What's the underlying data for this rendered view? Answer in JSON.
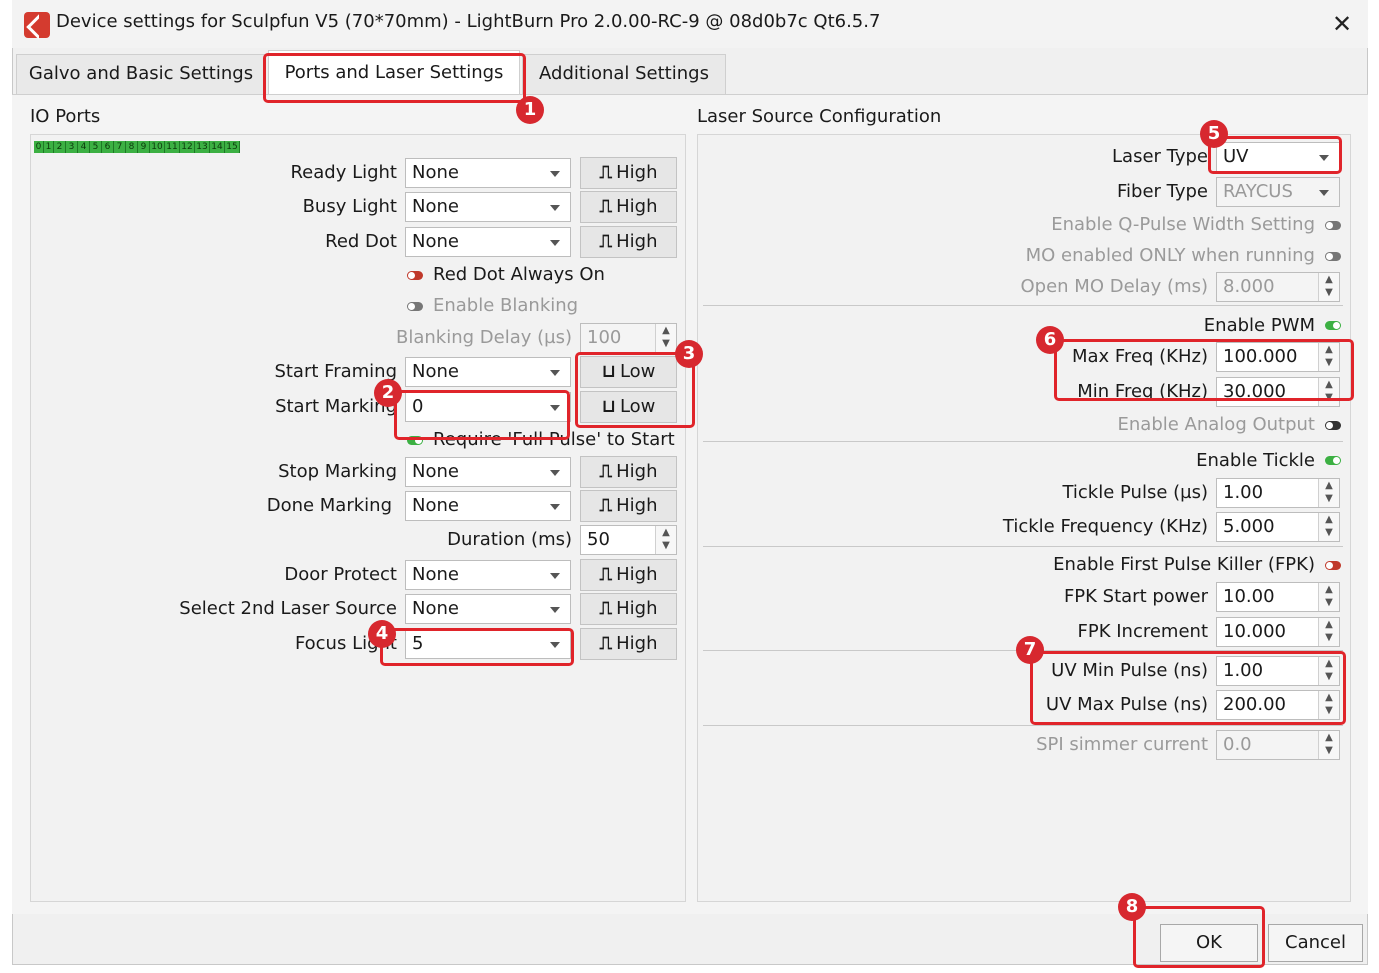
{
  "window": {
    "title": "Device settings for Sculpfun V5   (70*70mm)   - LightBurn Pro 2.0.00-RC-9 @ 08d0b7c Qt6.5.7",
    "close": "✕"
  },
  "tabs": [
    {
      "label": "Galvo and Basic Settings"
    },
    {
      "label": "Ports and Laser Settings"
    },
    {
      "label": "Additional Settings"
    }
  ],
  "io_ports": {
    "title": "IO Ports",
    "bits": [
      "0",
      "1",
      "2",
      "3",
      "4",
      "5",
      "6",
      "7",
      "8",
      "9",
      "10",
      "11",
      "12",
      "13",
      "14",
      "15"
    ],
    "rows": [
      {
        "label": "Ready Light",
        "value": "None",
        "polarity": "High",
        "symbol": "⎍"
      },
      {
        "label": "Busy Light",
        "value": "None",
        "polarity": "High",
        "symbol": "⎍"
      },
      {
        "label": "Red Dot",
        "value": "None",
        "polarity": "High",
        "symbol": "⎍"
      },
      {
        "label": "Start Framing",
        "value": "None",
        "polarity": "Low",
        "symbol": "⊔"
      },
      {
        "label": "Start Marking",
        "value": "0",
        "polarity": "Low",
        "symbol": "⊔"
      },
      {
        "label": "Stop Marking",
        "value": "None",
        "polarity": "High",
        "symbol": "⎍"
      },
      {
        "label": "Done Marking",
        "value": "None",
        "polarity": "High",
        "symbol": "⎍"
      },
      {
        "label": "Door Protect",
        "value": "None",
        "polarity": "High",
        "symbol": "⎍"
      },
      {
        "label": "Select 2nd Laser Source",
        "value": "None",
        "polarity": "High",
        "symbol": "⎍"
      },
      {
        "label": "Focus Light",
        "value": "5",
        "polarity": "High",
        "symbol": "⎍"
      }
    ],
    "red_dot_always_on": "Red Dot Always On",
    "enable_blanking": "Enable Blanking",
    "blanking_delay_label": "Blanking Delay (µs)",
    "blanking_delay_value": "100",
    "require_full_pulse": "Require 'Full Pulse' to Start",
    "duration_label": "Duration (ms)",
    "duration_value": "50"
  },
  "laser_source": {
    "title": "Laser Source Configuration",
    "laser_type_label": "Laser Type",
    "laser_type_value": "UV",
    "fiber_type_label": "Fiber Type",
    "fiber_type_value": "RAYCUS",
    "enable_q_pulse": "Enable Q-Pulse Width Setting",
    "mo_enabled": "MO enabled ONLY when running",
    "open_mo_delay_label": "Open MO Delay (ms)",
    "open_mo_delay_value": "8.000",
    "enable_pwm": "Enable PWM",
    "max_freq_label": "Max Freq (KHz)",
    "max_freq_value": "100.000",
    "min_freq_label": "Min Freq (KHz)",
    "min_freq_value": "30.000",
    "enable_analog": "Enable Analog Output",
    "enable_tickle": "Enable Tickle",
    "tickle_pulse_label": "Tickle Pulse (µs)",
    "tickle_pulse_value": "1.00",
    "tickle_freq_label": "Tickle Frequency (KHz)",
    "tickle_freq_value": "5.000",
    "enable_fpk": "Enable First Pulse Killer (FPK)",
    "fpk_start_label": "FPK Start power",
    "fpk_start_value": "10.00",
    "fpk_inc_label": "FPK Increment",
    "fpk_inc_value": "10.000",
    "uv_min_label": "UV Min Pulse (ns)",
    "uv_min_value": "1.00",
    "uv_max_label": "UV Max Pulse (ns)",
    "uv_max_value": "200.00",
    "spi_label": "SPI simmer current",
    "spi_value": "0.0"
  },
  "footer": {
    "ok": "OK",
    "cancel": "Cancel"
  },
  "badges": [
    "1",
    "2",
    "3",
    "4",
    "5",
    "6",
    "7",
    "8"
  ],
  "colors": {
    "highlight": "#e0242a",
    "toggle_on": "#3cb043",
    "bits": "#3cb043"
  }
}
